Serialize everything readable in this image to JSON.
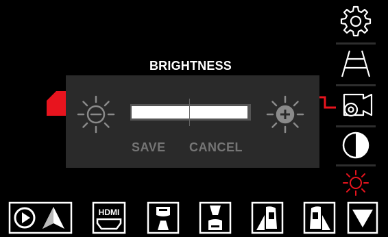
{
  "dialog": {
    "title": "BRIGHTNESS",
    "save_label": "SAVE",
    "cancel_label": "CANCEL",
    "brightness_level": 0.98,
    "decrease_icon": "brightness-decrease-icon",
    "increase_icon": "brightness-increase-icon"
  },
  "sidebar": {
    "items": [
      {
        "icon": "gear-icon"
      },
      {
        "icon": "road-lanes-icon"
      },
      {
        "icon": "camera-settings-icon"
      },
      {
        "icon": "contrast-icon"
      },
      {
        "icon": "brightness-icon",
        "active": true
      }
    ]
  },
  "bottom_bar": {
    "items": [
      {
        "icon": "play-navigation-icon"
      },
      {
        "icon": "hdmi-icon",
        "label": "HDMI"
      },
      {
        "icon": "front-camera-icon"
      },
      {
        "icon": "rear-camera-icon"
      },
      {
        "icon": "left-side-camera-icon"
      },
      {
        "icon": "right-side-camera-icon"
      },
      {
        "icon": "dropdown-arrow-icon"
      }
    ]
  },
  "colors": {
    "accent_red": "#e8141e",
    "dialog_bg": "#2a2a2a",
    "disabled_text": "#757575",
    "icon_gray": "#8a8a8a"
  }
}
